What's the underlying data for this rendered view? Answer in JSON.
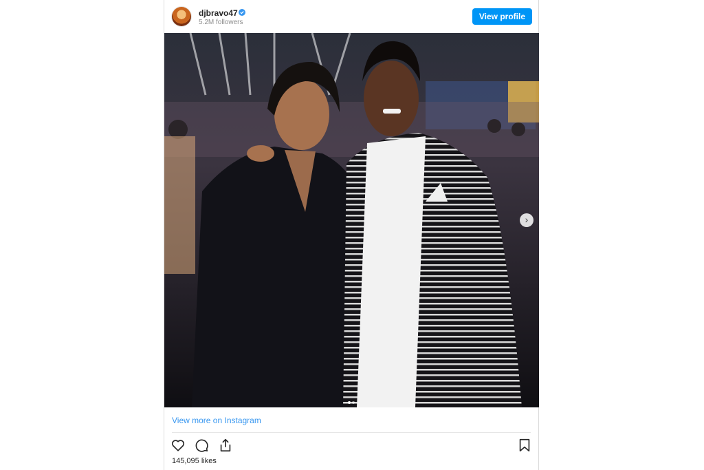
{
  "post": {
    "username": "djbravo47",
    "followers": "5.2M followers",
    "view_profile_label": "View profile",
    "photo_alt": "Two men posing together at an evening event",
    "view_more_label": "View more on Instagram",
    "likes": "145,095 likes",
    "carousel": {
      "current": 1,
      "total": 2
    }
  },
  "colors": {
    "accent": "#0095f6",
    "link": "#3897f0",
    "verified": "#3897f0"
  },
  "icons": {
    "verified": "verified-badge-icon",
    "like": "heart-icon",
    "comment": "comment-icon",
    "share": "share-icon",
    "save": "bookmark-icon",
    "next": "chevron-right-icon"
  }
}
